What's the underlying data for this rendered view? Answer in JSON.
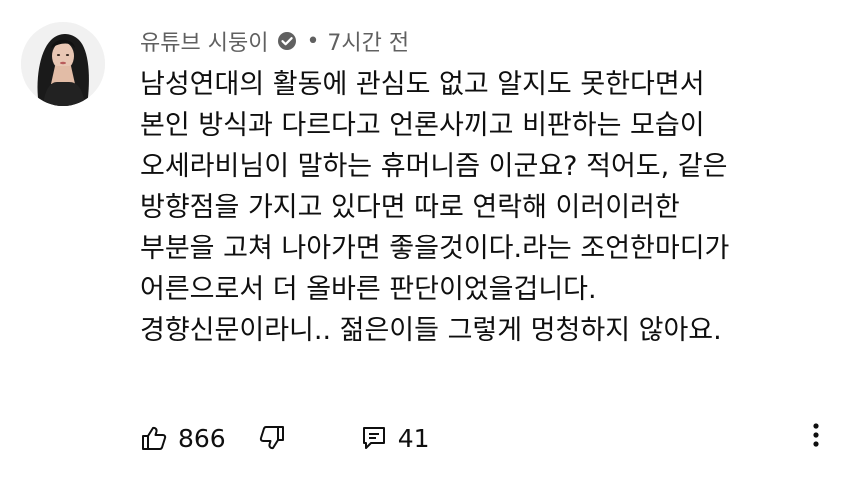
{
  "comment": {
    "author": "유튜브 시둥이",
    "time_separator": "•",
    "time": "7시간 전",
    "lines": [
      "남성연대의 활동에 관심도 없고 알지도 못한다면서",
      "본인 방식과 다르다고 언론사끼고 비판하는 모습이",
      "오세라비님이 말하는 휴머니즘 이군요? 적어도, 같은",
      "방향점을 가지고 있다면 따로 연락해 이러이러한",
      "부분을 고쳐 나아가면 좋을것이다.라는 조언한마디가",
      "어른으로서 더 올바른 판단이었을겁니다.",
      "경향신문이라니.. 젊은이들 그렇게 멍청하지 않아요."
    ]
  },
  "actions": {
    "like_count": "866",
    "reply_count": "41"
  },
  "icons": {
    "verified": "verified-check-icon",
    "like": "thumbs-up-icon",
    "dislike": "thumbs-down-icon",
    "reply": "reply-comment-icon",
    "more": "more-vertical-icon"
  }
}
